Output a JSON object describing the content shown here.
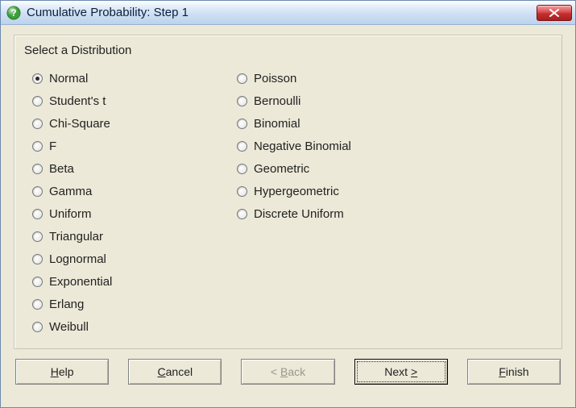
{
  "window": {
    "title": "Cumulative Probability: Step 1"
  },
  "heading": "Select a Distribution",
  "selected": "normal",
  "distributions": {
    "left": [
      {
        "id": "normal",
        "label": "Normal"
      },
      {
        "id": "students_t",
        "label": "Student's t"
      },
      {
        "id": "chi_square",
        "label": "Chi-Square"
      },
      {
        "id": "f",
        "label": "F"
      },
      {
        "id": "beta",
        "label": "Beta"
      },
      {
        "id": "gamma",
        "label": "Gamma"
      },
      {
        "id": "uniform",
        "label": "Uniform"
      },
      {
        "id": "triangular",
        "label": "Triangular"
      },
      {
        "id": "lognormal",
        "label": "Lognormal"
      },
      {
        "id": "exponential",
        "label": "Exponential"
      },
      {
        "id": "erlang",
        "label": "Erlang"
      },
      {
        "id": "weibull",
        "label": "Weibull"
      }
    ],
    "right": [
      {
        "id": "poisson",
        "label": "Poisson"
      },
      {
        "id": "bernoulli",
        "label": "Bernoulli"
      },
      {
        "id": "binomial",
        "label": "Binomial"
      },
      {
        "id": "negative_binomial",
        "label": "Negative Binomial"
      },
      {
        "id": "geometric",
        "label": "Geometric"
      },
      {
        "id": "hypergeometric",
        "label": "Hypergeometric"
      },
      {
        "id": "discrete_uniform",
        "label": "Discrete Uniform"
      }
    ]
  },
  "buttons": {
    "help": {
      "label": "Help",
      "mnemonic_index": 0,
      "enabled": true,
      "default": false
    },
    "cancel": {
      "label": "Cancel",
      "mnemonic_index": 0,
      "enabled": true,
      "default": false
    },
    "back": {
      "label": "< Back",
      "mnemonic_index": 2,
      "enabled": false,
      "default": false
    },
    "next": {
      "label": "Next >",
      "mnemonic_index": 5,
      "enabled": true,
      "default": true
    },
    "finish": {
      "label": "Finish",
      "mnemonic_index": 0,
      "enabled": true,
      "default": false
    }
  },
  "icons": {
    "app": "question-circle-icon",
    "close": "close-icon"
  }
}
